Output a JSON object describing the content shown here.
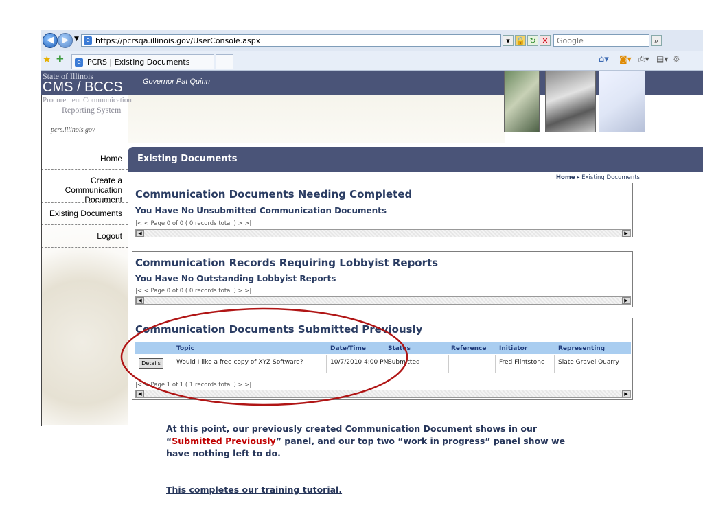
{
  "browser": {
    "url": "https://pcrsqa.illinois.gov/UserConsole.aspx",
    "search_placeholder": "Google",
    "tab_title": "PCRS | Existing Documents"
  },
  "header": {
    "state": "State of Illinois",
    "agency": "CMS / BCCS",
    "governor": "Governor Pat Quinn",
    "system_line1": "Procurement Communication",
    "system_line2": "Reporting System",
    "site": "pcrs.illinois.gov"
  },
  "sidebar": {
    "items": [
      {
        "label": "Home"
      },
      {
        "label_line1": "Create a Communication",
        "label_line2": "Document"
      },
      {
        "label": "Existing Documents"
      },
      {
        "label": "Logout"
      }
    ]
  },
  "page": {
    "title": "Existing Documents",
    "breadcrumb_home": "Home",
    "breadcrumb_current": "Existing Documents"
  },
  "panels": {
    "needing_completed": {
      "title": "Communication Documents Needing Completed",
      "message": "You Have No Unsubmitted Communication Documents",
      "pager": "|< <  Page 0 of 0 ( 0 records total )  > >|"
    },
    "lobbyist": {
      "title": "Communication Records Requiring Lobbyist Reports",
      "message": "You Have No Outstanding Lobbyist Reports",
      "pager": "|< <  Page 0 of 0 ( 0 records total )  > >|"
    },
    "submitted": {
      "title": "Communication Documents Submitted Previously",
      "columns": [
        "Topic",
        "Date/Time",
        "Status",
        "Reference",
        "Initiator",
        "Representing"
      ],
      "rows": [
        {
          "action": "Details",
          "topic": "Would I like a free copy of XYZ Software?",
          "datetime": "10/7/2010 4:00 PM",
          "status": "Submitted",
          "reference": "",
          "initiator": "Fred Flintstone",
          "representing": "Slate Gravel Quarry"
        }
      ],
      "pager": "|< <  Page 1 of 1 ( 1 records total )  > >|"
    }
  },
  "caption": {
    "line1": "At this point, our previously created Communication Document shows in our",
    "line2_pre": "“",
    "line2_highlight": "Submitted Previously",
    "line2_post": "” panel, and our top two “work in progress” panel show we",
    "line3": "have nothing left to do.",
    "footer": "This completes our training tutorial."
  },
  "colors": {
    "header_bg": "#4a5478",
    "title_text": "#2b3d63",
    "table_header": "#a9cdf0",
    "highlight_red": "#c00000",
    "ellipse": "#b01515"
  }
}
